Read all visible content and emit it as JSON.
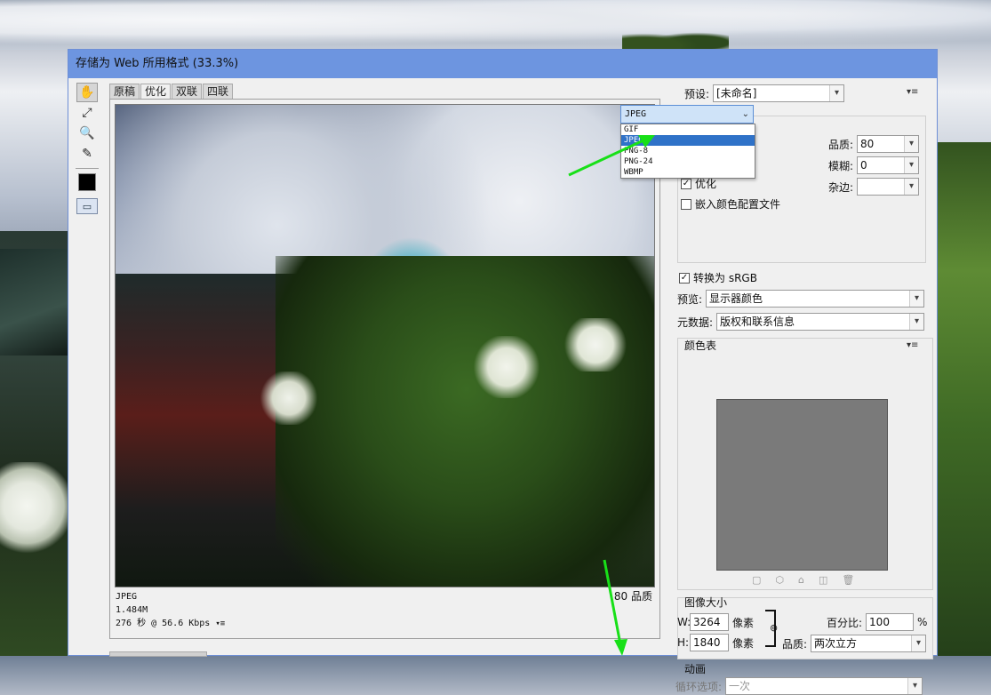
{
  "window": {
    "title": "存储为 Web 所用格式 (33.3%)"
  },
  "tools": {
    "hand": "✋",
    "slice": "⤢",
    "zoom": "🔍",
    "eyedropper": "✎",
    "frame": "▭"
  },
  "tabs": [
    "原稿",
    "优化",
    "双联",
    "四联"
  ],
  "image_info": {
    "format": "JPEG",
    "size": "1.484M",
    "time": "276 秒 @ 56.6 Kbps",
    "quality": "80 品质"
  },
  "preset": {
    "label": "预设:",
    "value": "[未命名]"
  },
  "format": {
    "value": "JPEG",
    "options": [
      "GIF",
      "JPEG",
      "PNG-8",
      "PNG-24",
      "WBMP"
    ],
    "selected_index": 1
  },
  "settings": {
    "quality_label": "品质:",
    "quality_value": "80",
    "blur_label": "模糊:",
    "blur_value": "0",
    "matte_label": "杂边:",
    "matte_value": "",
    "optimize_label": "优化",
    "optimize_checked": true,
    "embed_profile_label": "嵌入颜色配置文件",
    "embed_profile_checked": false
  },
  "convert": {
    "label": "转换为 sRGB",
    "checked": true
  },
  "preview": {
    "label": "预览:",
    "value": "显示器颜色"
  },
  "metadata": {
    "label": "元数据:",
    "value": "版权和联系信息"
  },
  "color_table": {
    "title": "颜色表",
    "swatch_color": "#7a7a7a"
  },
  "image_size": {
    "title": "图像大小",
    "w_label": "W:",
    "w_value": "3264",
    "w_unit": "像素",
    "h_label": "H:",
    "h_value": "1840",
    "h_unit": "像素",
    "percent_label": "百分比:",
    "percent_value": "100",
    "percent_unit": "%",
    "quality_label": "品质:",
    "quality_value": "两次立方"
  },
  "animation": {
    "title": "动画",
    "loop_label": "循环选项:",
    "loop_value": "一次"
  },
  "colors": {
    "title_bar": "#6d95e0",
    "selection": "#2f72c8",
    "arrow": "#18e018"
  }
}
